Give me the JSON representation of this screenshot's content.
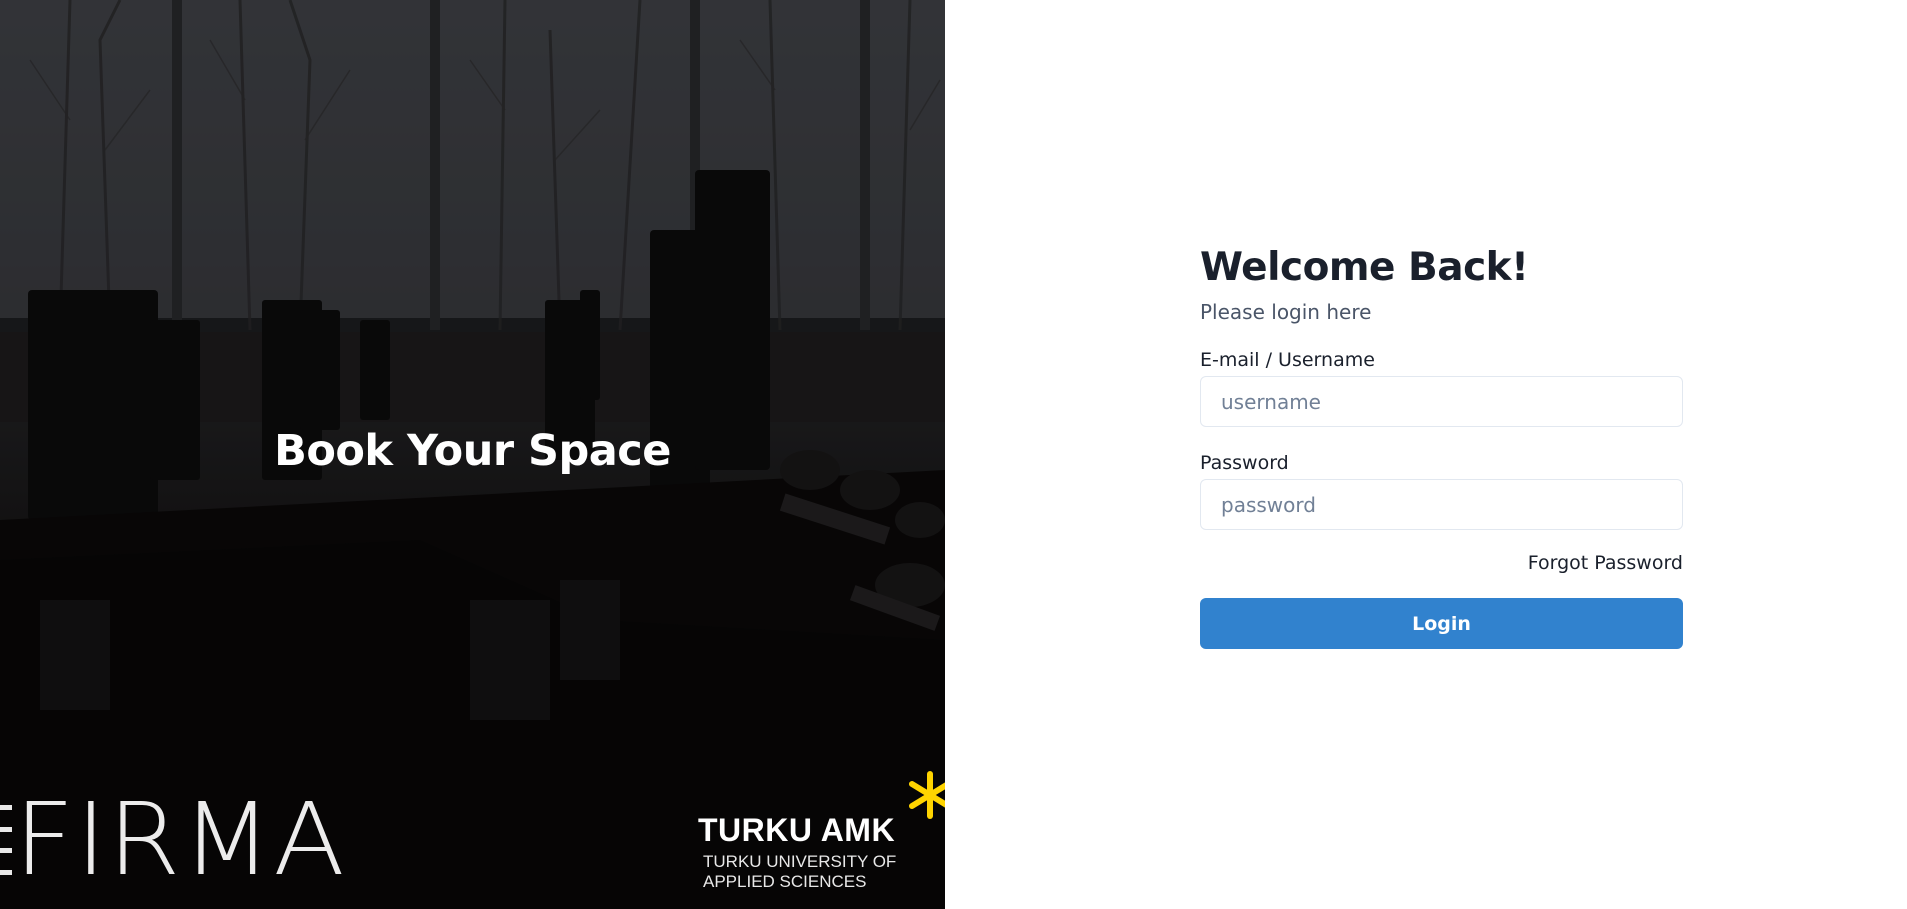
{
  "hero": {
    "title": "Book Your Space",
    "firma_logo_text": "FIRMA",
    "turku_logo": {
      "name": "TURKU AMK",
      "subtitle_line1": "TURKU UNIVERSITY OF",
      "subtitle_line2": "APPLIED SCIENCES",
      "star_color": "#FFD400"
    }
  },
  "login": {
    "heading": "Welcome Back!",
    "subheading": "Please login here",
    "username": {
      "label": "E-mail / Username",
      "placeholder": "username",
      "value": ""
    },
    "password": {
      "label": "Password",
      "placeholder": "password",
      "value": ""
    },
    "forgot_password_label": "Forgot Password",
    "login_button_label": "Login"
  },
  "colors": {
    "accent": "#3182CE",
    "heading": "#1A202C",
    "muted_text": "#4A5568"
  }
}
